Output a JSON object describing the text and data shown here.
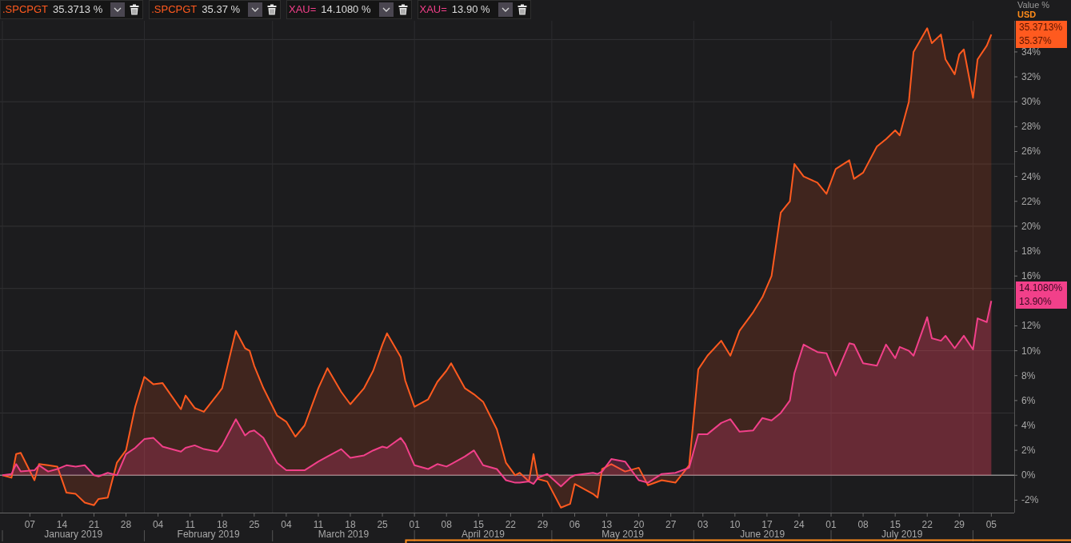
{
  "legend": [
    {
      "value": "35.3713 %"
    },
    {
      "value": "35.37 %"
    },
    {
      "value": "14.1080 %"
    },
    {
      "value": "13.90 %"
    }
  ],
  "axis_header": {
    "currency": "USD"
  },
  "last_value_tags": [
    {
      "lines": [
        "35.3713%",
        "35.37%"
      ]
    },
    {
      "lines": [
        "14.1080%",
        "13.90%"
      ]
    }
  ],
  "x_axis_months": [
    "January 2019",
    "February 2019",
    "March 2019",
    "April 2019",
    "May 2019",
    "June 2019",
    "July 2019"
  ],
  "chart_data": {
    "type": "area",
    "ylabel": "Value %",
    "x": [
      "2019-01-01",
      "2019-01-03",
      "2019-01-04",
      "2019-01-05",
      "2019-01-08",
      "2019-01-09",
      "2019-01-11",
      "2019-01-13",
      "2019-01-15",
      "2019-01-17",
      "2019-01-19",
      "2019-01-21",
      "2019-01-22",
      "2019-01-24",
      "2019-01-26",
      "2019-01-28",
      "2019-01-30",
      "2019-02-01",
      "2019-02-03",
      "2019-02-05",
      "2019-02-09",
      "2019-02-10",
      "2019-02-12",
      "2019-02-14",
      "2019-02-17",
      "2019-02-18",
      "2019-02-21",
      "2019-02-23",
      "2019-02-24",
      "2019-02-25",
      "2019-02-27",
      "2019-03-02",
      "2019-03-04",
      "2019-03-06",
      "2019-03-08",
      "2019-03-11",
      "2019-03-13",
      "2019-03-16",
      "2019-03-18",
      "2019-03-21",
      "2019-03-23",
      "2019-03-25",
      "2019-03-26",
      "2019-03-29",
      "2019-03-30",
      "2019-04-01",
      "2019-04-04",
      "2019-04-06",
      "2019-04-08",
      "2019-04-09",
      "2019-04-12",
      "2019-04-14",
      "2019-04-16",
      "2019-04-19",
      "2019-04-21",
      "2019-04-23",
      "2019-04-24",
      "2019-04-26",
      "2019-04-27",
      "2019-04-28",
      "2019-04-30",
      "2019-05-03",
      "2019-05-05",
      "2019-05-06",
      "2019-05-10",
      "2019-05-11",
      "2019-05-12",
      "2019-05-14",
      "2019-05-17",
      "2019-05-20",
      "2019-05-22",
      "2019-05-25",
      "2019-05-28",
      "2019-05-31",
      "2019-06-02",
      "2019-06-04",
      "2019-06-07",
      "2019-06-09",
      "2019-06-11",
      "2019-06-14",
      "2019-06-16",
      "2019-06-18",
      "2019-06-20",
      "2019-06-22",
      "2019-06-23",
      "2019-06-25",
      "2019-06-28",
      "2019-06-30",
      "2019-07-02",
      "2019-07-05",
      "2019-07-06",
      "2019-07-08",
      "2019-07-11",
      "2019-07-13",
      "2019-07-15",
      "2019-07-16",
      "2019-07-18",
      "2019-07-19",
      "2019-07-22",
      "2019-07-23",
      "2019-07-25",
      "2019-07-26",
      "2019-07-28",
      "2019-07-29",
      "2019-07-30",
      "2019-08-01",
      "2019-08-02",
      "2019-08-04",
      "2019-08-05"
    ],
    "series": [
      {
        "name": ".SPCPGT",
        "color": "#ff5a1f",
        "values": [
          0,
          -0.2,
          1.7,
          1.8,
          -0.4,
          0.9,
          0.8,
          0.7,
          -1.4,
          -1.5,
          -2.2,
          -2.4,
          -1.9,
          -1.8,
          1.0,
          2.0,
          5.5,
          7.9,
          7.3,
          7.4,
          5.3,
          6.4,
          5.4,
          5.1,
          6.5,
          7.0,
          11.6,
          10.2,
          10.0,
          8.8,
          7.0,
          4.8,
          4.3,
          3.1,
          4.0,
          7.0,
          8.6,
          6.7,
          5.7,
          7.0,
          8.4,
          10.5,
          11.4,
          9.5,
          7.6,
          5.5,
          6.1,
          7.5,
          8.4,
          9.0,
          7.0,
          6.5,
          5.9,
          3.7,
          1.0,
          0.0,
          0.2,
          -0.5,
          1.7,
          -0.3,
          -0.5,
          -2.6,
          -2.3,
          -0.7,
          -1.5,
          -1.8,
          0.5,
          0.9,
          0.3,
          0.6,
          -0.8,
          -0.4,
          -0.6,
          0.8,
          8.5,
          9.6,
          10.8,
          9.6,
          11.6,
          13.1,
          14.3,
          16.0,
          21.1,
          22.0,
          25.0,
          24.0,
          23.5,
          22.6,
          24.6,
          25.3,
          23.8,
          24.3,
          26.4,
          27.0,
          27.7,
          27.3,
          30.0,
          34.0,
          35.9,
          34.7,
          35.4,
          33.4,
          32.2,
          33.8,
          34.2,
          30.3,
          33.4,
          34.5,
          35.4
        ]
      },
      {
        "name": "XAU=",
        "color": "#f2408a",
        "values": [
          0,
          0.1,
          0.9,
          0.3,
          0.4,
          0.8,
          0.3,
          0.5,
          0.8,
          0.7,
          0.8,
          0.0,
          -0.1,
          0.2,
          0.0,
          1.7,
          2.2,
          2.9,
          3.0,
          2.3,
          1.9,
          2.2,
          2.4,
          2.1,
          1.9,
          2.4,
          4.5,
          3.2,
          3.5,
          3.6,
          3.0,
          1.0,
          0.4,
          0.4,
          0.4,
          1.1,
          1.5,
          2.1,
          1.4,
          1.6,
          2.0,
          2.3,
          2.2,
          3.0,
          2.5,
          0.8,
          0.5,
          0.9,
          0.7,
          0.9,
          1.5,
          2.0,
          0.8,
          0.5,
          -0.4,
          -0.6,
          -0.6,
          -0.5,
          -0.7,
          -0.2,
          0.1,
          -0.9,
          -0.2,
          0.0,
          0.2,
          0.1,
          0.3,
          1.3,
          1.1,
          -0.4,
          -0.6,
          0.1,
          0.2,
          0.6,
          3.3,
          3.3,
          4.2,
          4.5,
          3.5,
          3.6,
          4.6,
          4.4,
          5.0,
          6.0,
          8.2,
          10.5,
          9.9,
          9.8,
          8.0,
          10.6,
          10.5,
          9.0,
          8.8,
          10.5,
          9.4,
          10.3,
          10.0,
          9.6,
          12.7,
          11.0,
          10.8,
          11.2,
          10.2,
          10.7,
          11.2,
          10.1,
          12.6,
          12.3,
          14.0
        ]
      }
    ],
    "grid": true,
    "xlim": [
      "2019-01-01",
      "2019-08-10"
    ],
    "ylim": [
      -3,
      36.5
    ],
    "xticks": [
      {
        "value": "2019-01-07",
        "label": "07"
      },
      {
        "value": "2019-01-14",
        "label": "14"
      },
      {
        "value": "2019-01-21",
        "label": "21"
      },
      {
        "value": "2019-01-28",
        "label": "28"
      },
      {
        "value": "2019-02-04",
        "label": "04"
      },
      {
        "value": "2019-02-11",
        "label": "11"
      },
      {
        "value": "2019-02-18",
        "label": "18"
      },
      {
        "value": "2019-02-25",
        "label": "25"
      },
      {
        "value": "2019-03-04",
        "label": "04"
      },
      {
        "value": "2019-03-11",
        "label": "11"
      },
      {
        "value": "2019-03-18",
        "label": "18"
      },
      {
        "value": "2019-03-25",
        "label": "25"
      },
      {
        "value": "2019-04-01",
        "label": "01"
      },
      {
        "value": "2019-04-08",
        "label": "08"
      },
      {
        "value": "2019-04-15",
        "label": "15"
      },
      {
        "value": "2019-04-22",
        "label": "22"
      },
      {
        "value": "2019-04-29",
        "label": "29"
      },
      {
        "value": "2019-05-06",
        "label": "06"
      },
      {
        "value": "2019-05-13",
        "label": "13"
      },
      {
        "value": "2019-05-20",
        "label": "20"
      },
      {
        "value": "2019-05-27",
        "label": "27"
      },
      {
        "value": "2019-06-03",
        "label": "03"
      },
      {
        "value": "2019-06-10",
        "label": "10"
      },
      {
        "value": "2019-06-17",
        "label": "17"
      },
      {
        "value": "2019-06-24",
        "label": "24"
      },
      {
        "value": "2019-07-01",
        "label": "01"
      },
      {
        "value": "2019-07-08",
        "label": "08"
      },
      {
        "value": "2019-07-15",
        "label": "15"
      },
      {
        "value": "2019-07-22",
        "label": "22"
      },
      {
        "value": "2019-07-29",
        "label": "29"
      },
      {
        "value": "2019-08-05",
        "label": "05"
      }
    ],
    "yticks": [
      {
        "value": -2,
        "label": "-2%"
      },
      {
        "value": 0,
        "label": "0%"
      },
      {
        "value": 2,
        "label": "2%"
      },
      {
        "value": 4,
        "label": "4%"
      },
      {
        "value": 6,
        "label": "6%"
      },
      {
        "value": 8,
        "label": "8%"
      },
      {
        "value": 10,
        "label": "10%"
      },
      {
        "value": 12,
        "label": "12%"
      },
      {
        "value": 16,
        "label": "16%"
      },
      {
        "value": 18,
        "label": "18%"
      },
      {
        "value": 20,
        "label": "20%"
      },
      {
        "value": 22,
        "label": "22%"
      },
      {
        "value": 24,
        "label": "24%"
      },
      {
        "value": 26,
        "label": "26%"
      },
      {
        "value": 28,
        "label": "28%"
      },
      {
        "value": 30,
        "label": "30%"
      },
      {
        "value": 32,
        "label": "32%"
      },
      {
        "value": 34,
        "label": "34%"
      }
    ]
  }
}
